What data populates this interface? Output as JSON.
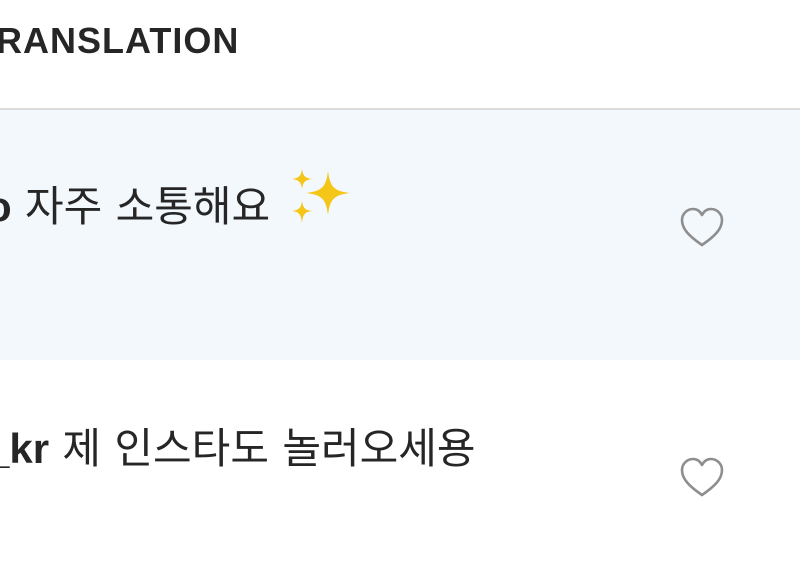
{
  "header": {
    "title": "RANSLATION"
  },
  "comments": [
    {
      "username": "o",
      "text": " 자주 소통해요",
      "emoji": "sparkles-icon",
      "highlighted": true
    },
    {
      "username": "_kr",
      "text": " 제 인스타도 놀러오세용",
      "highlighted": false
    }
  ],
  "colors": {
    "highlight_bg": "#f3f8fd",
    "divider": "#dbdbdb",
    "text": "#262626",
    "heart_outline": "#8e8e8e",
    "sparkle": "#f5c518"
  }
}
